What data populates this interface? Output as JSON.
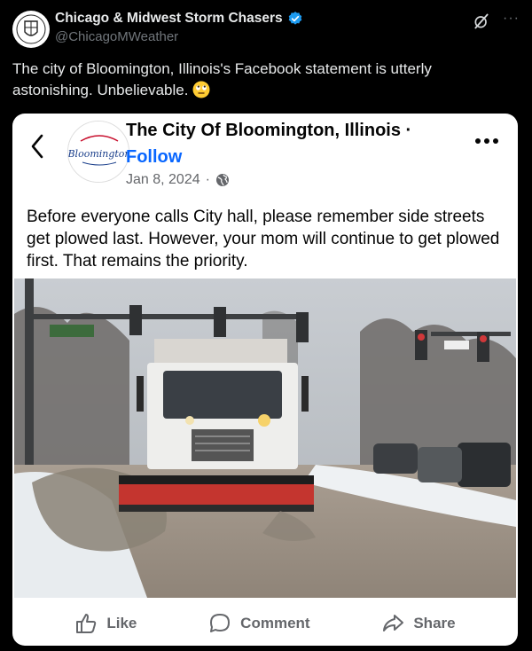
{
  "tweet": {
    "author_name": "Chicago & Midwest Storm Chasers",
    "handle": "@ChicagoMWeather",
    "avatar_label": "Chicago & Midwest Storm Chasers",
    "text": "The city of Bloomington, Illinois's Facebook statement is utterly astonishing. Unbelievable.",
    "emoji": "rolling-eyes-emoji"
  },
  "card": {
    "page_name": "The City Of Bloomington, Illinois",
    "page_name_dot": "·",
    "follow_label": "Follow",
    "date": "Jan 8, 2024",
    "meta_sep": "·",
    "avatar_logo_text": "Bloomington",
    "post_text": "Before everyone calls City hall, please remember side streets get plowed last. However, your mom will continue to get plowed first. That remains the priority.",
    "actions": [
      {
        "label": "Like",
        "icon": "thumbs-up-icon"
      },
      {
        "label": "Comment",
        "icon": "comment-icon"
      },
      {
        "label": "Share",
        "icon": "share-icon"
      }
    ]
  },
  "colors": {
    "background": "#000000",
    "verified_badge": "#1d9bf0",
    "follow_blue": "#0866ff",
    "muted_gray": "#71767b"
  }
}
